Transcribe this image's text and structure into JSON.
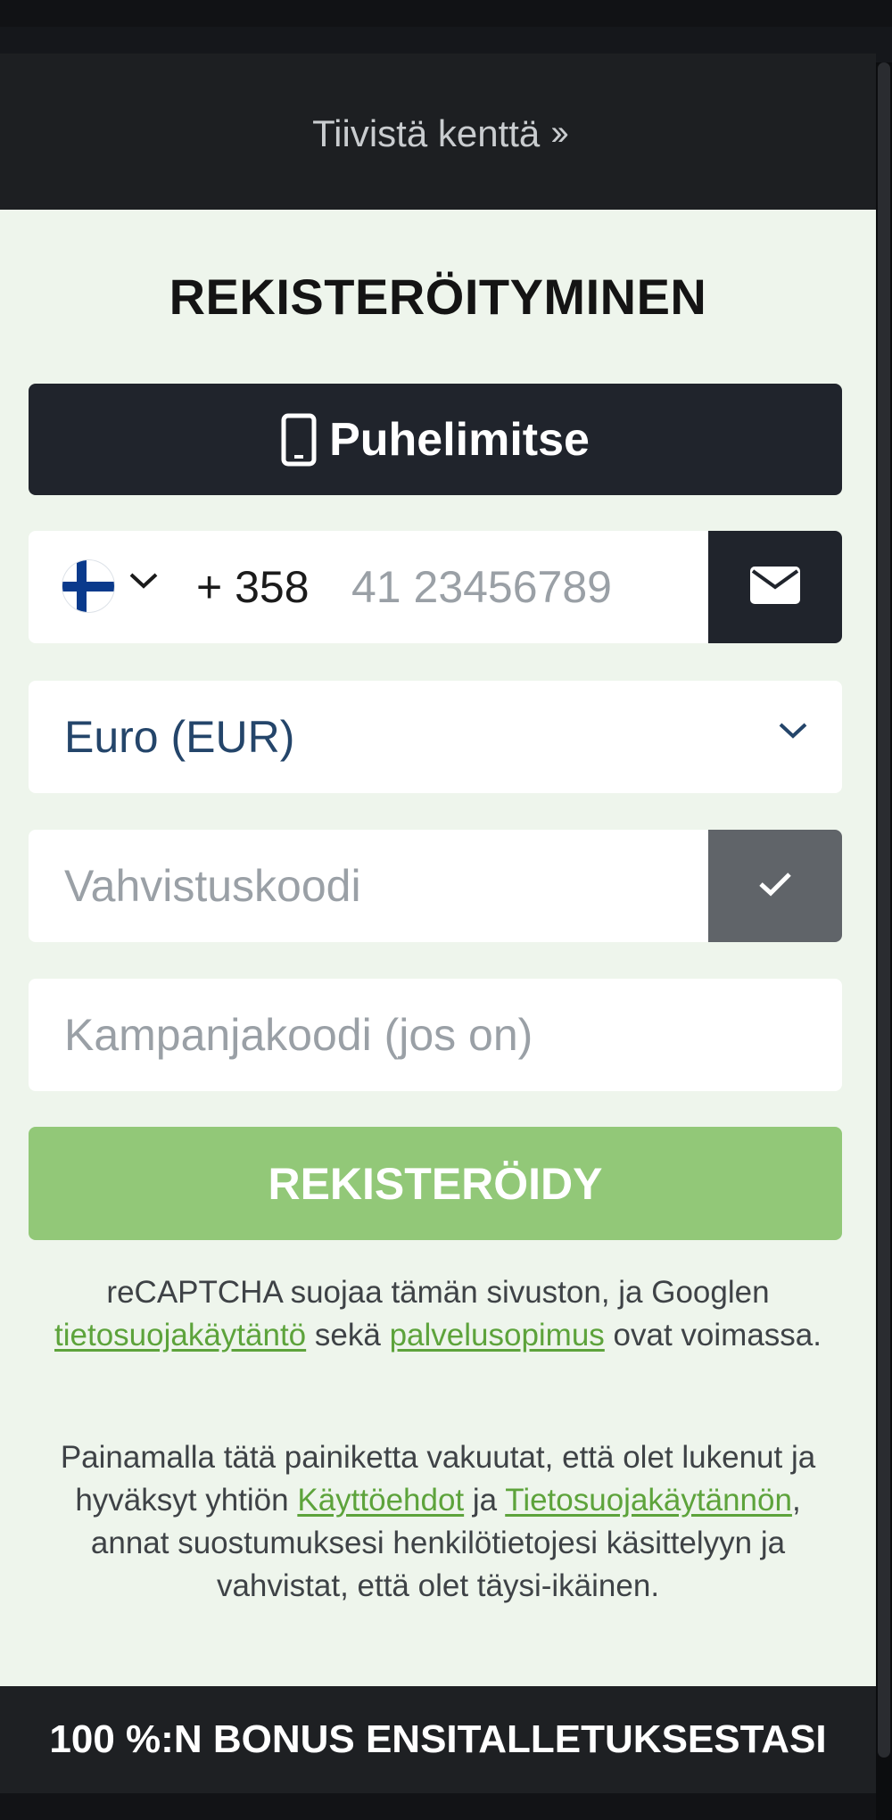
{
  "collapse": {
    "label": "Tiivistä kenttä",
    "icon": "double-chevron-right-icon"
  },
  "form": {
    "title": "REKISTERÖITYMINEN",
    "method_button": {
      "label": "Puhelimitse",
      "icon": "mobile-phone-icon"
    },
    "phone": {
      "country_flag": "finland-flag-icon",
      "dial_code": "+ 358",
      "placeholder": "41 23456789",
      "email_switch_icon": "envelope-icon"
    },
    "currency": {
      "selected": "Euro (EUR)",
      "icon": "chevron-down-icon"
    },
    "verification_code": {
      "placeholder": "Vahvistuskoodi",
      "confirm_icon": "checkmark-icon"
    },
    "promo_code": {
      "placeholder": "Kampanjakoodi (jos on)"
    },
    "submit_label": "REKISTERÖIDY",
    "recaptcha": {
      "text_before": "reCAPTCHA suojaa tämän sivuston, ja Googlen",
      "privacy_link": "tietosuojakäytäntö",
      "text_middle": "sekä",
      "terms_link": "palvelusopimus",
      "text_after": "ovat voimassa."
    },
    "consent": {
      "text_before": "Painamalla tätä painiketta vakuutat, että olet lukenut ja hyväksyt yhtiön",
      "terms_link": "Käyttöehdot",
      "text_middle": "ja",
      "privacy_link": "Tietosuojakäytännön",
      "text_after": ", annat suostumuksesi henkilötietojesi käsittelyyn ja vahvistat, että olet täysi-ikäinen."
    }
  },
  "bonus_banner": "100 %:N BONUS ENSITALLETUKSESTASI",
  "colors": {
    "page_bg": "#15171b",
    "panel_bg": "#eef5ec",
    "dark_button": "#20242c",
    "submit_green": "#92c878",
    "link_green": "#5da33b",
    "confirm_gray": "#606469"
  }
}
